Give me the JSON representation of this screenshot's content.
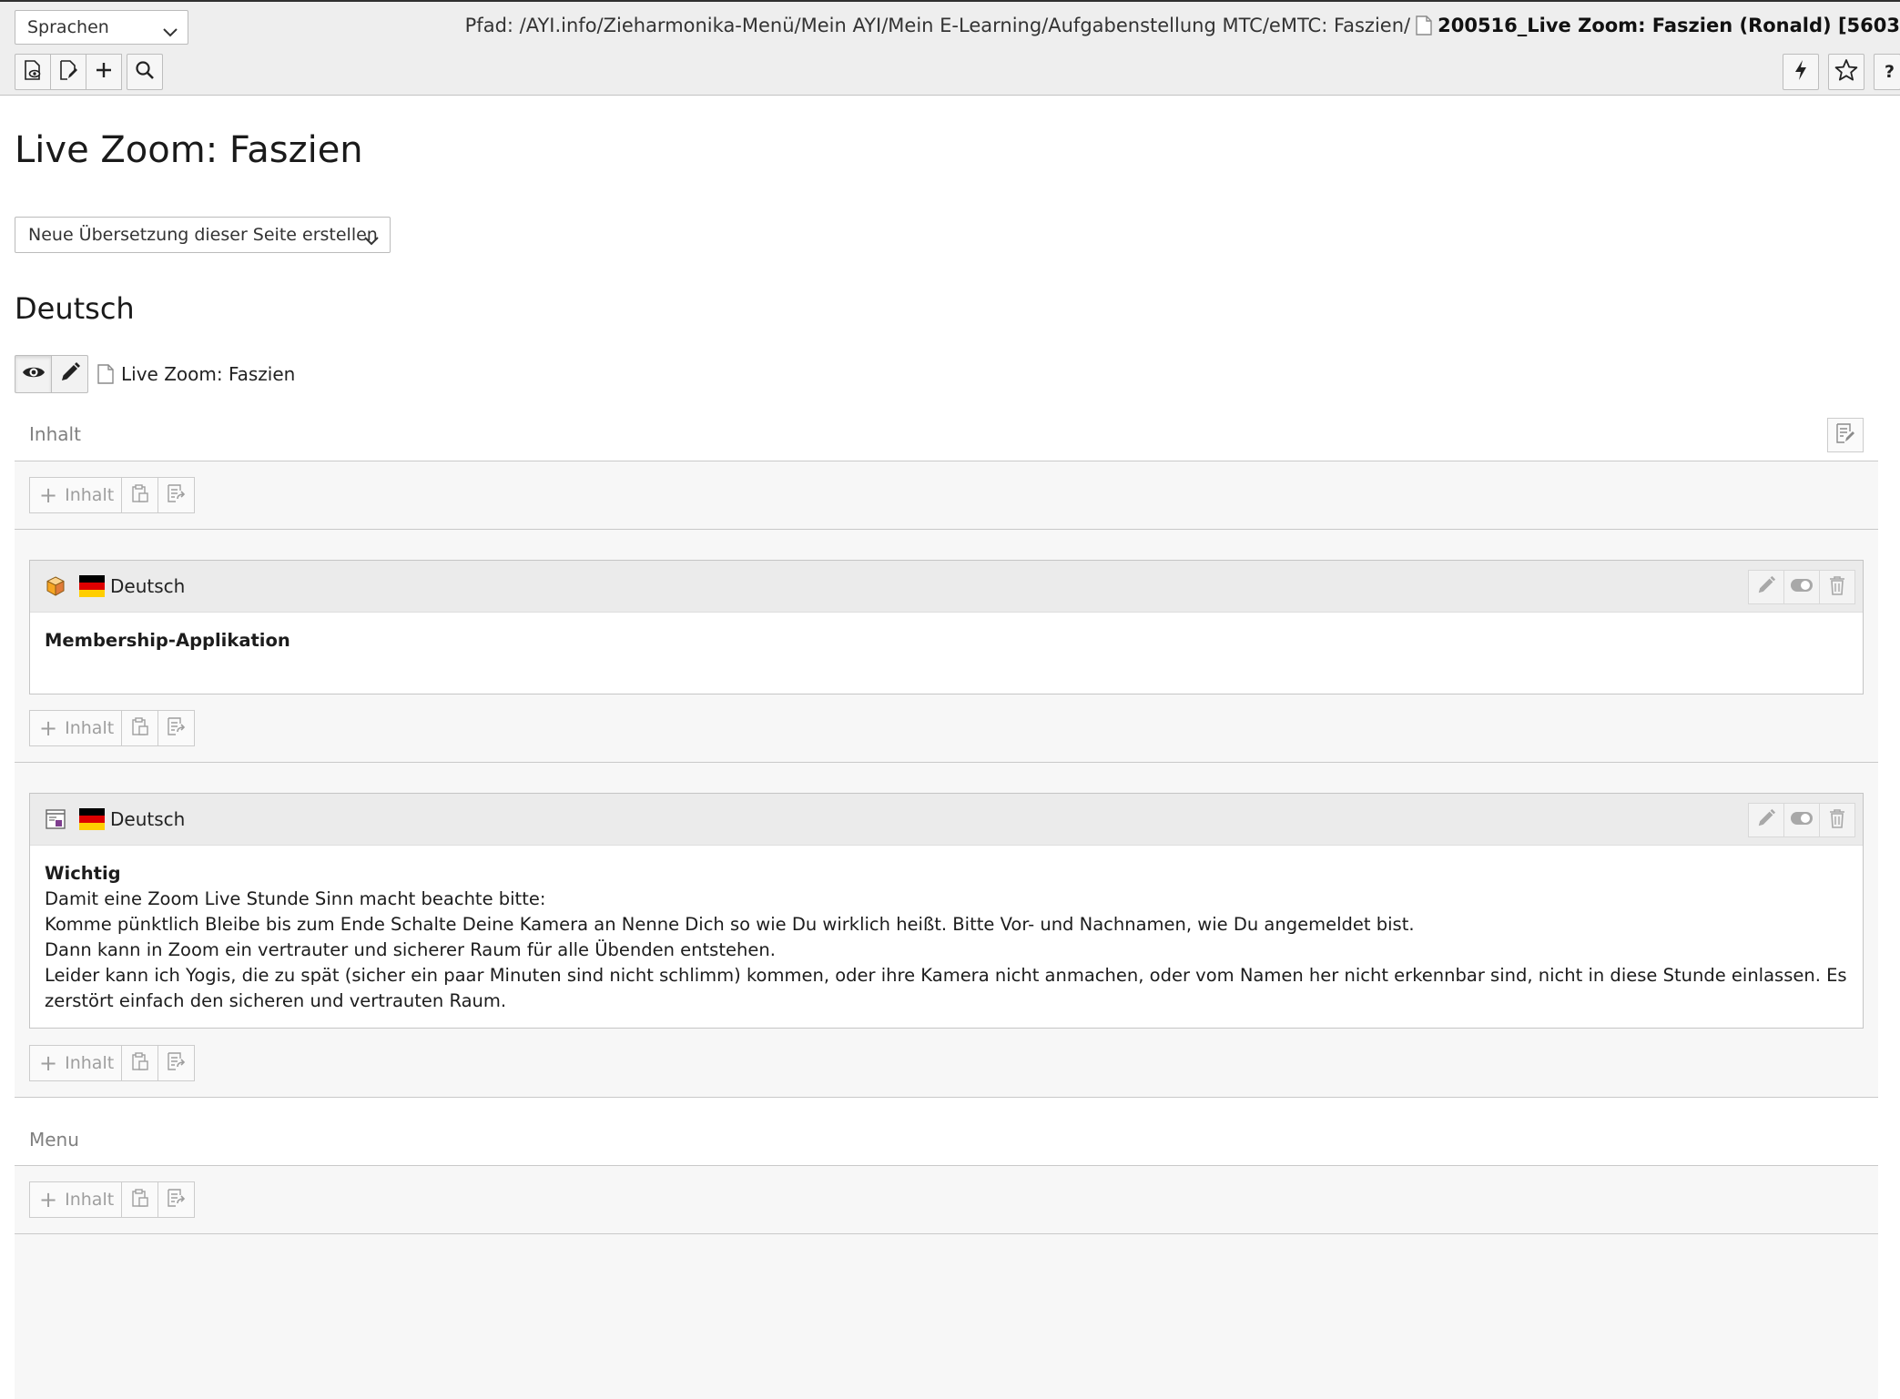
{
  "header": {
    "language_select": "Sprachen",
    "path_prefix": "Pfad: /AYI.info/Zieharmonika-Menü/Mein AYI/Mein E-Learning/Aufgabenstellung MTC/eMTC: Faszien/",
    "record_title": "200516_Live Zoom: Faszien (Ronald) [5603",
    "left_buttons": [
      "view-page-icon",
      "edit-page-icon",
      "new-record-icon",
      "search-icon"
    ],
    "right_buttons": [
      "clear-cache-icon",
      "bookmark-icon",
      "help-icon"
    ],
    "help_label": "?"
  },
  "page": {
    "title": "Live Zoom: Faszien",
    "translation_select": "Neue Übersetzung dieser Seite erstellen",
    "language_heading": "Deutsch",
    "page_title_row": "Live Zoom: Faszien"
  },
  "columns": [
    {
      "name": "Inhalt"
    },
    {
      "name": "Menu"
    }
  ],
  "add_content_label": "Inhalt",
  "content_elements": [
    {
      "type_icon": "content-box-icon",
      "language": "Deutsch",
      "heading": "Membership-Applikation",
      "lines": []
    },
    {
      "type_icon": "content-plugin-icon",
      "language": "Deutsch",
      "heading": "Wichtig",
      "lines": [
        "Damit eine Zoom Live Stunde Sinn macht beachte bitte:",
        "Komme pünktlich Bleibe bis zum Ende Schalte Deine Kamera an Nenne Dich so wie Du wirklich heißt. Bitte Vor- und Nachnamen, wie Du angemeldet bist.",
        "Dann kann in Zoom ein vertrauter und sicherer Raum für alle Übenden  entstehen.",
        "Leider kann ich Yogis, die zu spät (sicher ein paar Minuten sind nicht schlimm) kommen, oder ihre Kamera nicht anmachen, oder vom Namen her nicht erkennbar sind, nicht in diese Stunde einlassen. Es zerstört einfach den sicheren und vertrauten Raum."
      ]
    }
  ],
  "colors": {
    "flag_black": "#000000",
    "flag_red": "#dd0000",
    "flag_gold": "#ffce00"
  }
}
